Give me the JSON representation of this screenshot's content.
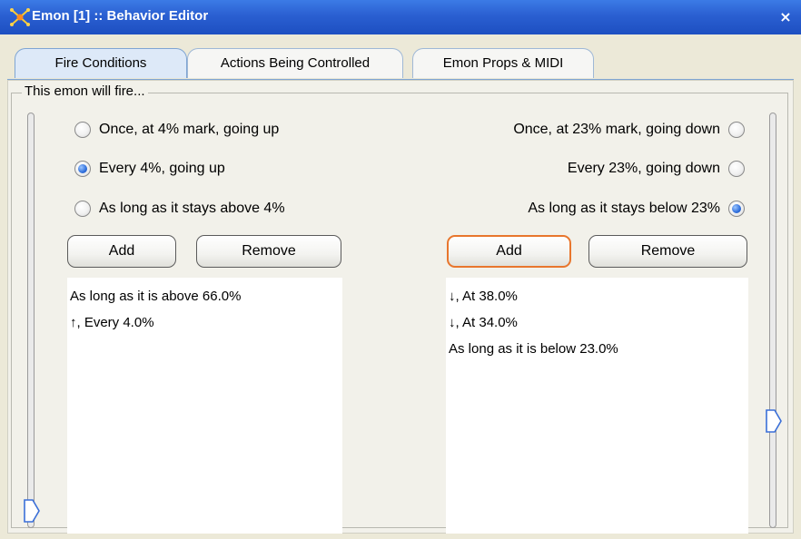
{
  "window": {
    "title": "Emon [1] :: Behavior Editor",
    "close_label": "×"
  },
  "tabs": [
    {
      "label": "Fire Conditions",
      "active": true
    },
    {
      "label": "Actions Being Controlled",
      "active": false
    },
    {
      "label": "Emon Props & MIDI",
      "active": false
    }
  ],
  "group_title": "This emon will fire...",
  "left": {
    "options": [
      {
        "label": "Once, at 4% mark, going up",
        "checked": false
      },
      {
        "label": "Every 4%, going up",
        "checked": true
      },
      {
        "label": "As long as it stays above 4%",
        "checked": false
      }
    ],
    "add_label": "Add",
    "remove_label": "Remove",
    "list": [
      "As long as it is above 66.0%",
      "↑, Every 4.0%"
    ],
    "slider_level": 0.0
  },
  "right": {
    "options": [
      {
        "label": "Once, at 23% mark, going down",
        "checked": false
      },
      {
        "label": "Every 23%, going down",
        "checked": false
      },
      {
        "label": "As long as it stays below 23%",
        "checked": true
      }
    ],
    "add_label": "Add",
    "remove_label": "Remove",
    "list": [
      "↓, At 38.0%",
      "↓, At 34.0%",
      "As long as it is below 23.0%"
    ],
    "slider_level": 0.23
  },
  "colors": {
    "titlebar": "#2a5fd1",
    "focus_ring": "#e8762d",
    "radio_checked": "#2f6fdc"
  }
}
